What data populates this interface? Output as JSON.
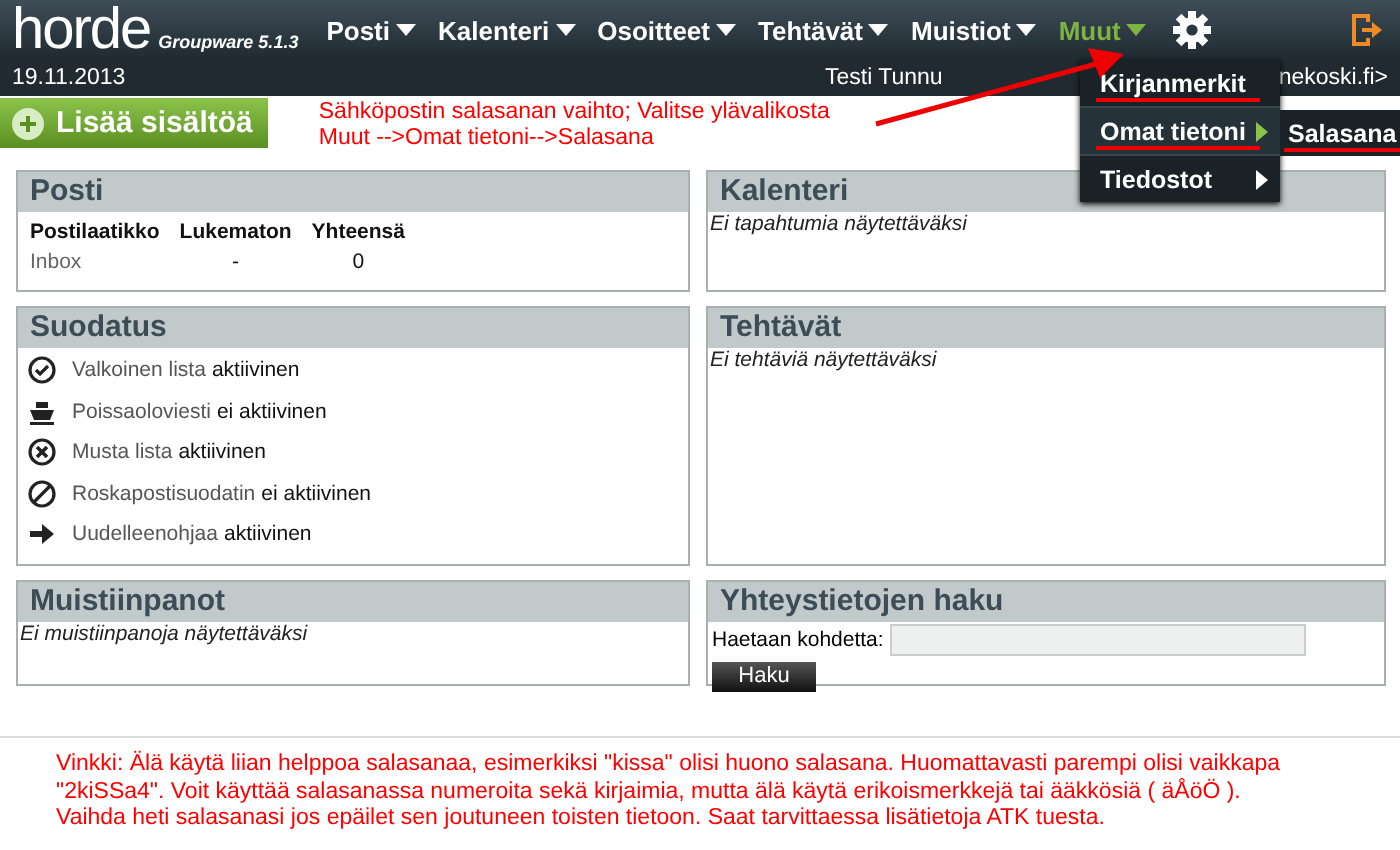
{
  "header": {
    "logo": "horde",
    "product": "Groupware 5.1.3",
    "nav": [
      {
        "label": "Posti",
        "selected": false
      },
      {
        "label": "Kalenteri",
        "selected": false
      },
      {
        "label": "Osoitteet",
        "selected": false
      },
      {
        "label": "Tehtävät",
        "selected": false
      },
      {
        "label": "Muistiot",
        "selected": false
      },
      {
        "label": "Muut",
        "selected": true
      }
    ]
  },
  "sub_bar": {
    "date": "19.11.2013",
    "user_fragments": [
      "Testi Tunnu",
      "nekoski.fi>"
    ]
  },
  "dropdown": {
    "items": [
      {
        "label": "Kirjanmerkit",
        "kind": "link",
        "expanded": false,
        "underlined": true
      },
      {
        "label": "Omat tietoni",
        "kind": "submenu",
        "expanded": true,
        "underlined": true
      },
      {
        "label": "Tiedostot",
        "kind": "submenu",
        "expanded": false,
        "underlined": false
      }
    ],
    "submenu": [
      {
        "label": "Salasana",
        "underlined": true
      }
    ]
  },
  "add_button": "Lisää sisältöä",
  "annotation": [
    "Sähköpostin salasanan vaihto; Valitse ylävalikosta",
    "Muut -->Omat tietoni-->Salasana"
  ],
  "left_panels": [
    {
      "kind": "mail",
      "title": "Posti",
      "columns": [
        "Postilaatikko",
        "Lukematon",
        "Yhteensä"
      ],
      "rows": [
        [
          "Inbox",
          "-",
          "0"
        ]
      ]
    },
    {
      "kind": "filters",
      "title": "Suodatus",
      "filters": [
        {
          "kind": "check",
          "name": "Valkoinen lista",
          "status": "aktiivinen"
        },
        {
          "kind": "vacation",
          "name": "Poissaoloviesti",
          "status": "ei aktiivinen"
        },
        {
          "kind": "blacklist",
          "name": "Musta lista",
          "status": "aktiivinen"
        },
        {
          "kind": "spam",
          "name": "Roskapostisuodatin",
          "status": "ei aktiivinen"
        },
        {
          "kind": "forward",
          "name": "Uudelleenohjaa",
          "status": "aktiivinen"
        }
      ]
    },
    {
      "kind": "note",
      "title": "Muistiinpanot",
      "message": "Ei muistiinpanoja näytettäväksi"
    }
  ],
  "right_panels": [
    {
      "kind": "note",
      "title": "Kalenteri",
      "message": "Ei tapahtumia näytettäväksi"
    },
    {
      "kind": "note",
      "title": "Tehtävät",
      "message": "Ei tehtäviä näytettäväksi"
    },
    {
      "kind": "search",
      "title": "Yhteystietojen haku",
      "label": "Haetaan kohdetta:",
      "button": "Haku"
    }
  ],
  "footer_tip": [
    "Vinkki: Älä käytä liian helppoa salasanaa, esimerkiksi \"kissa\" olisi huono salasana. Huomattavasti parempi olisi vaikkapa",
    "\"2kiSSa4\". Voit käyttää salasanassa numeroita sekä kirjaimia, mutta älä käytä erikoismerkkejä tai ääkkösiä ( äÅöÖ ).",
    "Vaihda heti salasanasi jos epäilet sen joutuneen toisten tietoon. Saat tarvittaessa lisätietoja ATK tuesta."
  ]
}
